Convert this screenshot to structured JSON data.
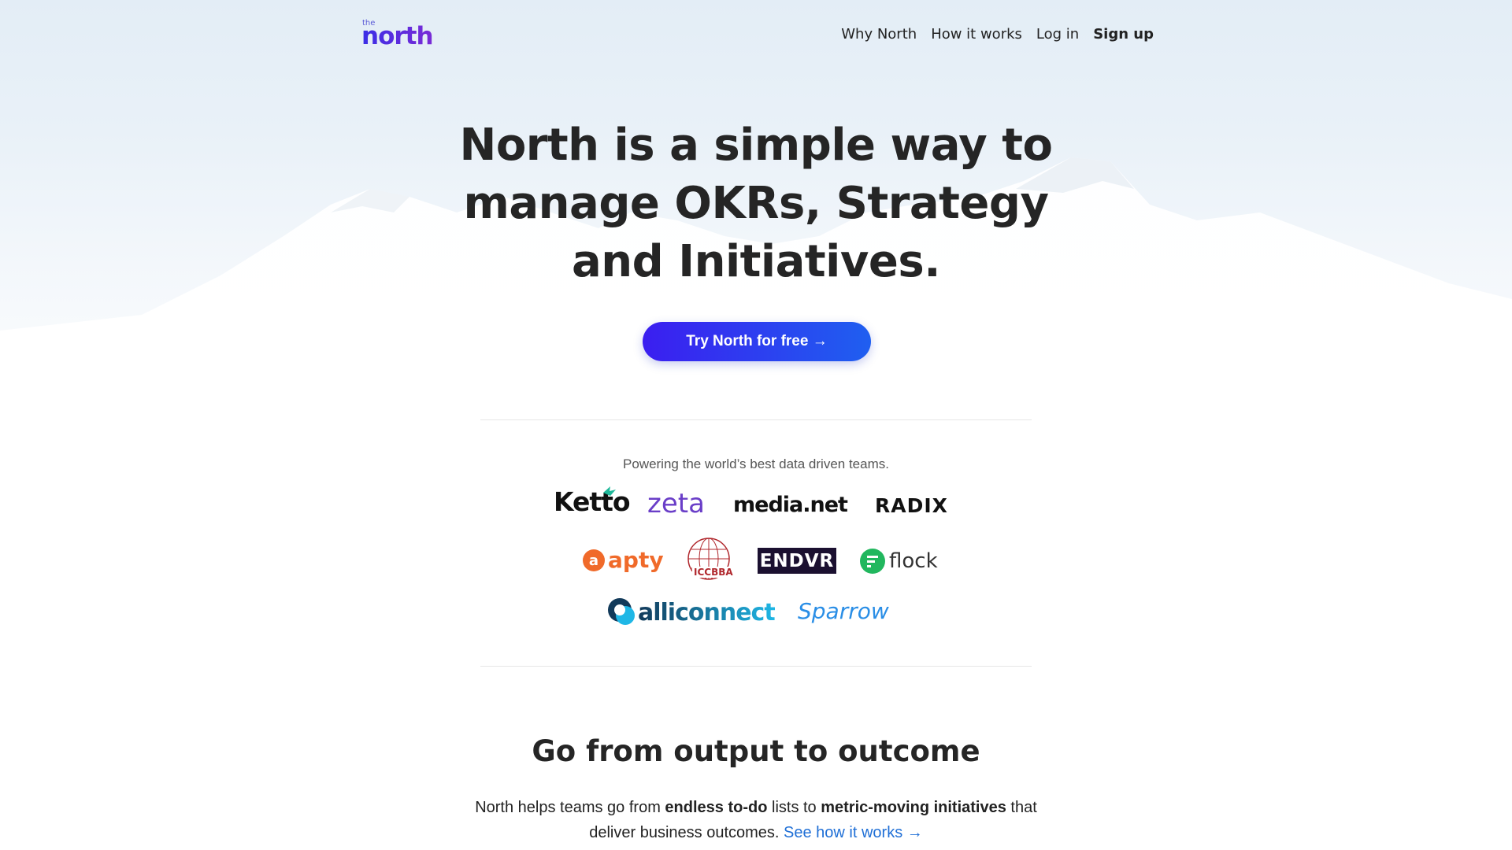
{
  "logo": {
    "small": "the",
    "word": "north"
  },
  "nav": {
    "links": [
      "Why North",
      "How it works",
      "Log in"
    ],
    "signup": "Sign up"
  },
  "hero": {
    "title_line1": "North is a simple way to",
    "title_line2": "manage OKRs, Strategy",
    "title_line3": "and Initiatives.",
    "cta": "Try North for free →"
  },
  "customers": {
    "tagline": "Powering the world’s best data driven teams.",
    "logos": [
      "Ketto",
      "zeta",
      "media.net",
      "RADIX",
      "apty",
      "ICCBBA",
      "ENDVR",
      "flock",
      "alliconnect",
      "Sparrow"
    ]
  },
  "section": {
    "title": "Go from output to outcome",
    "body_1": "North helps teams go from ",
    "body_b1": "endless to-do",
    "body_2": " lists to ",
    "body_b2": "metric-moving initiatives",
    "body_3": " that deliver business outcomes. ",
    "link": "See how it works →"
  },
  "colors": {
    "brand": "#3b2ee6",
    "cta_start": "#3b1ef0",
    "cta_end": "#1f5ff0",
    "link": "#1f6fd6"
  }
}
